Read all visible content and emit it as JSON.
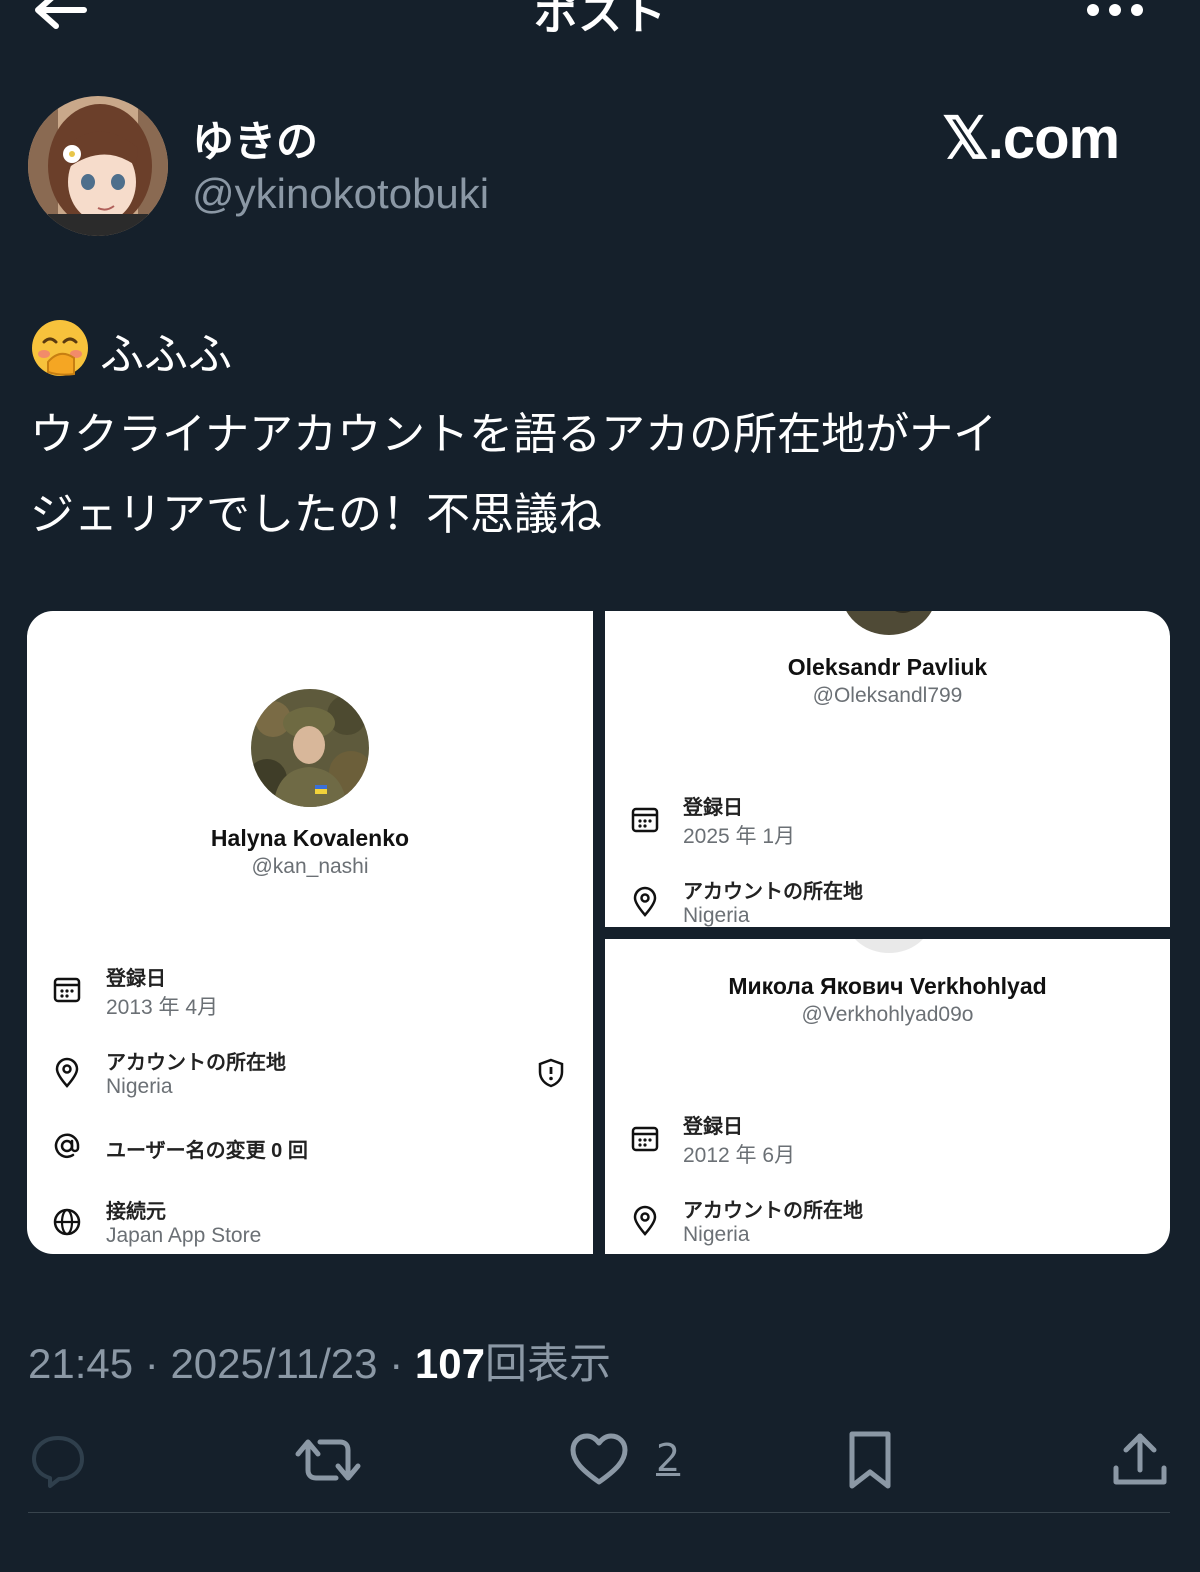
{
  "header": {
    "title": "ポスト",
    "back_icon": "arrow-left-icon",
    "more_icon": "more-dots-icon"
  },
  "author": {
    "display_name": "ゆきの",
    "handle": "@ykinokotobuki"
  },
  "watermark": "𝕏.com",
  "post": {
    "emoji": "hand-over-mouth-emoji",
    "line1": "ふふふ",
    "line2": "ウクライナアカウントを語るアカの所在地がナイ",
    "line3": "ジェリアでしたの！不思議ね"
  },
  "media": {
    "left": {
      "name": "Halyna Kovalenko",
      "handle": "@kan_nashi",
      "joined_label": "登録日",
      "joined_value": "2013 年 4月",
      "location_label": "アカウントの所在地",
      "location_value": "Nigeria",
      "username_changes": "ユーザー名の変更 0 回",
      "connected_label": "接続元",
      "connected_value": "Japan App Store"
    },
    "top_right": {
      "name": "Oleksandr Pavliuk",
      "handle": "@Oleksandl799",
      "joined_label": "登録日",
      "joined_value": "2025 年 1月",
      "location_label": "アカウントの所在地",
      "location_value": "Nigeria"
    },
    "bottom_right": {
      "name": "Микола Якович Verkhohlyad",
      "handle": "@Verkhohlyad09o",
      "joined_label": "登録日",
      "joined_value": "2012 年 6月",
      "location_label": "アカウントの所在地",
      "location_value": "Nigeria"
    }
  },
  "meta": {
    "time": "21:45",
    "date": "2025/11/23",
    "views": "107",
    "views_label": "回表示"
  },
  "actions": {
    "like_count": "2"
  },
  "colors": {
    "background": "#15202b",
    "secondary_text": "#8b98a5",
    "divider": "#38444d"
  }
}
